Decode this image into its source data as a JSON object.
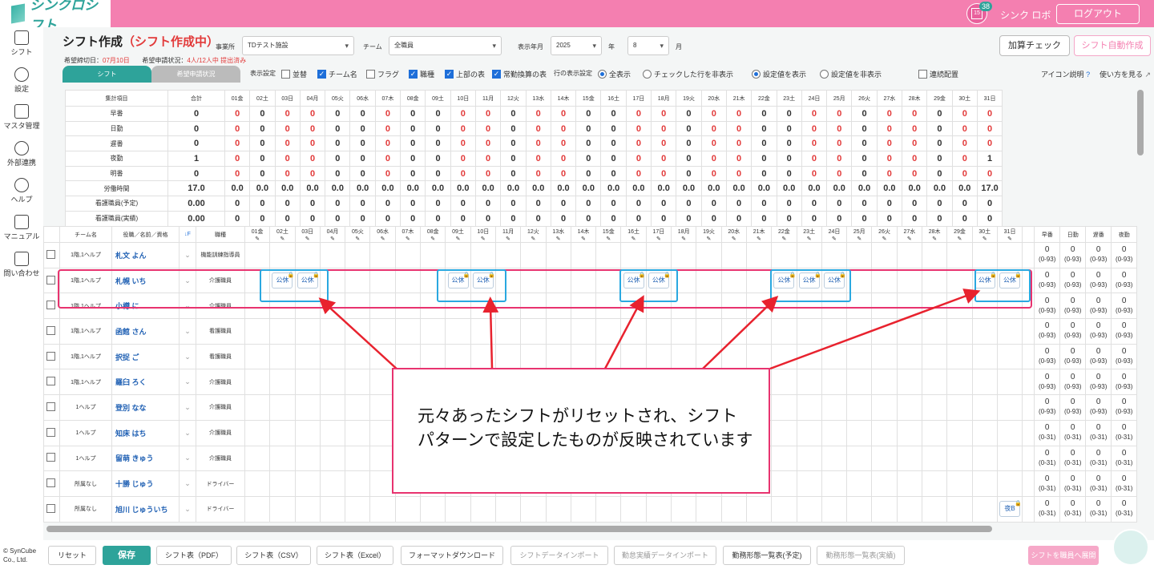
{
  "app": {
    "logo": "シンクロシフト",
    "user": "シンク ロボ",
    "logout": "ログアウト",
    "badge_count": "38",
    "calendar_day": "15"
  },
  "sidebar": [
    {
      "label": "シフト",
      "icon": "calendar-icon"
    },
    {
      "label": "設定",
      "icon": "gear-icon"
    },
    {
      "label": "マスタ管理",
      "icon": "database-icon"
    },
    {
      "label": "外部連携",
      "icon": "cloud-icon"
    },
    {
      "label": "ヘルプ",
      "icon": "help-icon"
    },
    {
      "label": "マニュアル",
      "icon": "edit-icon"
    },
    {
      "label": "問い合わせ",
      "icon": "mail-icon"
    }
  ],
  "page": {
    "title": "シフト作成",
    "status": "（シフト作成中）",
    "deadline_label": "希望締切日：",
    "deadline": "07月10日",
    "request_label": "希望申請状況：",
    "request_status": "4人/12人中 提出済み"
  },
  "filters": {
    "office_label": "事業所",
    "office": "TDテスト施設",
    "team_label": "チーム",
    "team": "全職員",
    "period_label": "表示年月",
    "year": "2025",
    "year_unit": "年",
    "month": "8",
    "month_unit": "月"
  },
  "actions": {
    "check": "加算チェック",
    "auto": "シフト自動作成"
  },
  "tabs": {
    "shift": "シフト",
    "requests": "希望申請状況"
  },
  "display": {
    "label": "表示設定",
    "options": [
      {
        "label": "並替",
        "checked": false
      },
      {
        "label": "チーム名",
        "checked": true
      },
      {
        "label": "フラグ",
        "checked": false
      },
      {
        "label": "職種",
        "checked": true
      },
      {
        "label": "上部の表",
        "checked": true
      },
      {
        "label": "常勤換算の表",
        "checked": true
      }
    ],
    "row_label": "行の表示設定",
    "row_opts": [
      {
        "label": "全表示",
        "on": true
      },
      {
        "label": "チェックした行を非表示",
        "on": false
      }
    ],
    "val_opts": [
      {
        "label": "設定値を表示",
        "on": true
      },
      {
        "label": "設定値を非表示",
        "on": false
      }
    ],
    "consecutive": "連続配置",
    "icon_help": "アイコン説明",
    "howto": "使い方を見る"
  },
  "days": [
    "01金",
    "02土",
    "03日",
    "04月",
    "05火",
    "06水",
    "07木",
    "08金",
    "09土",
    "10日",
    "11月",
    "12火",
    "13水",
    "14木",
    "15金",
    "16土",
    "17日",
    "18月",
    "19火",
    "20水",
    "21木",
    "22金",
    "23土",
    "24日",
    "25月",
    "26火",
    "27水",
    "28木",
    "29金",
    "30土",
    "31日"
  ],
  "summary": {
    "header": [
      "集計項目",
      "合計"
    ],
    "rows": [
      {
        "label": "早番",
        "total": "0",
        "values": [
          "0",
          "0",
          "0",
          "0",
          "0",
          "0",
          "0",
          "0",
          "0",
          "0",
          "0",
          "0",
          "0",
          "0",
          "0",
          "0",
          "0",
          "0",
          "0",
          "0",
          "0",
          "0",
          "0",
          "0",
          "0",
          "0",
          "0",
          "0",
          "0",
          "0",
          "0"
        ]
      },
      {
        "label": "日勤",
        "total": "0",
        "values": [
          "0",
          "0",
          "0",
          "0",
          "0",
          "0",
          "0",
          "0",
          "0",
          "0",
          "0",
          "0",
          "0",
          "0",
          "0",
          "0",
          "0",
          "0",
          "0",
          "0",
          "0",
          "0",
          "0",
          "0",
          "0",
          "0",
          "0",
          "0",
          "0",
          "0",
          "0"
        ]
      },
      {
        "label": "遅番",
        "total": "0",
        "values": [
          "0",
          "0",
          "0",
          "0",
          "0",
          "0",
          "0",
          "0",
          "0",
          "0",
          "0",
          "0",
          "0",
          "0",
          "0",
          "0",
          "0",
          "0",
          "0",
          "0",
          "0",
          "0",
          "0",
          "0",
          "0",
          "0",
          "0",
          "0",
          "0",
          "0",
          "0"
        ]
      },
      {
        "label": "夜勤",
        "total": "1",
        "values": [
          "0",
          "0",
          "0",
          "0",
          "0",
          "0",
          "0",
          "0",
          "0",
          "0",
          "0",
          "0",
          "0",
          "0",
          "0",
          "0",
          "0",
          "0",
          "0",
          "0",
          "0",
          "0",
          "0",
          "0",
          "0",
          "0",
          "0",
          "0",
          "0",
          "0",
          "1"
        ]
      },
      {
        "label": "明番",
        "total": "0",
        "values": [
          "0",
          "0",
          "0",
          "0",
          "0",
          "0",
          "0",
          "0",
          "0",
          "0",
          "0",
          "0",
          "0",
          "0",
          "0",
          "0",
          "0",
          "0",
          "0",
          "0",
          "0",
          "0",
          "0",
          "0",
          "0",
          "0",
          "0",
          "0",
          "0",
          "0",
          "0"
        ]
      },
      {
        "label": "労働時間",
        "total": "17.0",
        "values": [
          "0.0",
          "0.0",
          "0.0",
          "0.0",
          "0.0",
          "0.0",
          "0.0",
          "0.0",
          "0.0",
          "0.0",
          "0.0",
          "0.0",
          "0.0",
          "0.0",
          "0.0",
          "0.0",
          "0.0",
          "0.0",
          "0.0",
          "0.0",
          "0.0",
          "0.0",
          "0.0",
          "0.0",
          "0.0",
          "0.0",
          "0.0",
          "0.0",
          "0.0",
          "0.0",
          "17.0"
        ]
      },
      {
        "label": "看護職員(予定)",
        "total": "0.00",
        "values": [
          "0",
          "0",
          "0",
          "0",
          "0",
          "0",
          "0",
          "0",
          "0",
          "0",
          "0",
          "0",
          "0",
          "0",
          "0",
          "0",
          "0",
          "0",
          "0",
          "0",
          "0",
          "0",
          "0",
          "0",
          "0",
          "0",
          "0",
          "0",
          "0",
          "0",
          "0"
        ]
      },
      {
        "label": "看護職員(実績)",
        "total": "0.00",
        "values": [
          "0",
          "0",
          "0",
          "0",
          "0",
          "0",
          "0",
          "0",
          "0",
          "0",
          "0",
          "0",
          "0",
          "0",
          "0",
          "0",
          "0",
          "0",
          "0",
          "0",
          "0",
          "0",
          "0",
          "0",
          "0",
          "0",
          "0",
          "0",
          "0",
          "0",
          "0"
        ]
      }
    ]
  },
  "staff_header": {
    "team": "チーム名",
    "name": "役職／名前／資格",
    "job": "職種",
    "extra": [
      "早番",
      "日勤",
      "遅番",
      "夜勤"
    ]
  },
  "staff": [
    {
      "team": "1階,1ヘルプ",
      "name": "札文 よん",
      "job": "機能訓練指導員",
      "range": "(0-93)",
      "shifts": {}
    },
    {
      "team": "1階,1ヘルプ",
      "name": "札幌 いち",
      "job": "介護職員",
      "range": "(0-93)",
      "shifts": {
        "2": "公休",
        "3": "公休",
        "9": "公休",
        "10": "公休",
        "16": "公休",
        "17": "公休",
        "22": "公休",
        "23": "公休",
        "24": "公休",
        "30": "公休",
        "31": "公休"
      }
    },
    {
      "team": "1階,1ヘルプ",
      "name": "小樽 に",
      "job": "介護職員",
      "range": "(0-93)",
      "shifts": {}
    },
    {
      "team": "1階,1ヘルプ",
      "name": "函館 さん",
      "job": "看護職員",
      "range": "(0-93)",
      "shifts": {}
    },
    {
      "team": "1階,1ヘルプ",
      "name": "択捉 ご",
      "job": "看護職員",
      "range": "(0-93)",
      "shifts": {}
    },
    {
      "team": "1階,1ヘルプ",
      "name": "羅臼 ろく",
      "job": "介護職員",
      "range": "(0-93)",
      "shifts": {}
    },
    {
      "team": "1ヘルプ",
      "name": "登別 なな",
      "job": "介護職員",
      "range": "(0-93)",
      "shifts": {}
    },
    {
      "team": "1ヘルプ",
      "name": "知床 はち",
      "job": "介護職員",
      "range": "(0-31)",
      "shifts": {}
    },
    {
      "team": "1ヘルプ",
      "name": "留萌 きゅう",
      "job": "介護職員",
      "range": "(0-31)",
      "shifts": {}
    },
    {
      "team": "所属なし",
      "name": "十勝 じゅう",
      "job": "ドライバー",
      "range": "(0-31)",
      "shifts": {}
    },
    {
      "team": "所属なし",
      "name": "旭川 じゅういち",
      "job": "ドライバー",
      "range": "(0-31)",
      "shifts": {
        "31": "夜B"
      }
    }
  ],
  "callout": "元々あったシフトがリセットされ、シフトパターンで設定したものが反映されています",
  "bottom": {
    "copyright": "© SynCube Co., Ltd.",
    "buttons": [
      "リセット",
      "保存",
      "シフト表（PDF）",
      "シフト表（CSV）",
      "シフト表（Excel）",
      "フォーマットダウンロード",
      "シフトデータインポート",
      "勤怠実績データインポート",
      "勤務形態一覧表(予定)",
      "勤務形態一覧表(実績)"
    ],
    "publish": "シフトを職員へ展開"
  }
}
